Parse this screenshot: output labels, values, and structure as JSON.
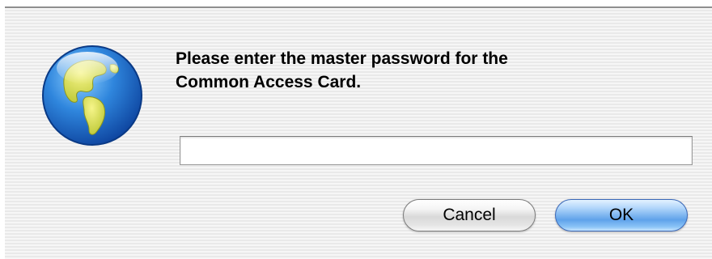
{
  "dialog": {
    "icon": "globe-icon",
    "message_line1": "Please enter the master password for the",
    "message_line2": "Common Access Card.",
    "password_value": "",
    "cancel_label": "Cancel",
    "ok_label": "OK",
    "colors": {
      "default_button": "#6aa8ec",
      "background_stripe": "#e9e9e9"
    }
  }
}
